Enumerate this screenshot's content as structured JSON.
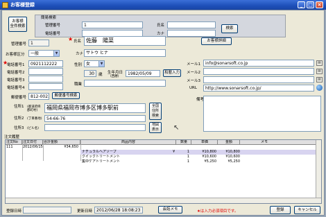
{
  "window": {
    "title": "お客様登録",
    "minimize": "_",
    "maximize": "□",
    "close": "×"
  },
  "search": {
    "group_label": "簡易検索",
    "customer_no_label": "管理番号",
    "customer_no_value": "1",
    "name_label": "氏名",
    "name_value": "",
    "phone_label": "電話番号",
    "phone_value": "",
    "kana_label": "カナ",
    "kana_value": "",
    "search_button": "検索"
  },
  "toolbar": {
    "all_search_button": "お客様\n全件検索",
    "customer_detail_button": "お客様詳細"
  },
  "customer": {
    "mgmt_no_label": "管理番号",
    "mgmt_no_value": "1",
    "category_label": "お客様区分",
    "category_value": "一般",
    "name_label": "氏名",
    "name_value": "佐藤　陽菜",
    "kana_label": "カナ",
    "kana_value": "サトウ ヒナ",
    "phone1_label": "電話番号1",
    "phone1_value": "0921112222",
    "phone2_label": "電話番号2",
    "phone2_value": "",
    "phone3_label": "電話番号3",
    "phone3_value": "",
    "phone4_label": "電話番号4",
    "phone4_value": "",
    "gender_label": "性別",
    "gender_value": "女",
    "age_value": "30",
    "age_unit": "歳",
    "birth_label": "生年月日",
    "birth_sub": "(西暦)",
    "birth_value": "1982/05/09",
    "calendar_button": "和暦入力",
    "occupation_label": "職業",
    "occupation_value": "",
    "zip_label": "郵便番号",
    "zip_value": "812-0023",
    "zip_search_button": "郵便番号検索",
    "addr1_label": "住所1",
    "addr1_sub": "(都道府県\n郡町村)",
    "addr1_value": "福岡県福岡市博多区博多駅前",
    "addr2_label": "住所2",
    "addr2_sub": "(丁目番地)",
    "addr2_value": "54-66-76",
    "addr3_label": "住所3",
    "addr3_sub": "(ビル名)",
    "addr3_value": "",
    "address_search_button": "全国\n住所\n検索",
    "map_button": "地図\n表示",
    "mail1_label": "メール1",
    "mail1_value": "info@sonarsoft.co.jp",
    "mail2_label": "メール2",
    "mail2_value": "",
    "mail3_label": "メール3",
    "mail3_value": "",
    "url_label": "URL",
    "url_value": "http://www.sonarsoft.co.jp/",
    "notes_label": "備考",
    "notes_value": ""
  },
  "orders": {
    "section_label": "注文履歴",
    "columns": [
      "注文No",
      "注文日付",
      "合計金額",
      "商品内容",
      "数量",
      "単価",
      "金額",
      "メモ"
    ],
    "order_row": {
      "no": "111",
      "date": "2012/06/15",
      "total": "¥34,650"
    },
    "items": [
      {
        "name": "ナチュラルヘアソープ",
        "price_mark": "¥",
        "qty": "1",
        "unit": "¥10,800",
        "amount": "¥10,800"
      },
      {
        "name": "クイックトリートメント",
        "price_mark": "",
        "qty": "1",
        "unit": "¥10,600",
        "amount": "¥10,600"
      },
      {
        "name": "集中ケアトリートメント",
        "price_mark": "",
        "qty": "1",
        "unit": "¥5,250",
        "amount": "¥5,250"
      }
    ]
  },
  "footer": {
    "created_label": "登録日時",
    "created_value": "",
    "updated_label": "更新日時",
    "updated_value": "2012/06/28 18:08:23",
    "memo_button": "会話メモ",
    "required_note": "★は入力必須項目です。",
    "register_button": "登録",
    "cancel_button": "キャンセル"
  },
  "colors": {
    "titlebar": "#1d4fb8",
    "required": "#e00000",
    "form_bg": "#ece9d8"
  }
}
